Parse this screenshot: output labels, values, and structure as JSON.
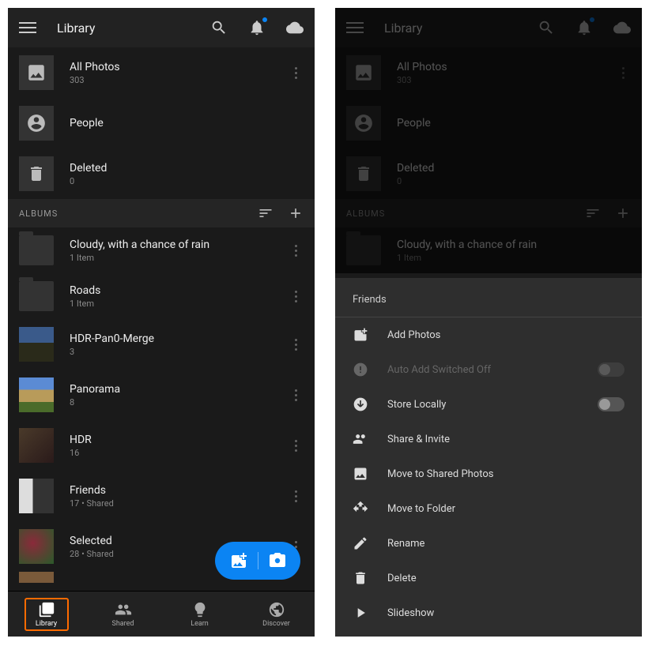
{
  "header": {
    "title": "Library"
  },
  "library": {
    "all_photos": {
      "label": "All Photos",
      "count": "303"
    },
    "people": {
      "label": "People"
    },
    "deleted": {
      "label": "Deleted",
      "count": "0"
    }
  },
  "albums_section": {
    "title": "ALBUMS"
  },
  "albums": [
    {
      "label": "Cloudy, with a chance of rain",
      "sub": "1 Item"
    },
    {
      "label": "Roads",
      "sub": "1 Item"
    },
    {
      "label": "HDR-Pan0-Merge",
      "sub": "3"
    },
    {
      "label": "Panorama",
      "sub": "8"
    },
    {
      "label": "HDR",
      "sub": "16"
    },
    {
      "label": "Friends",
      "sub": "17 • Shared"
    },
    {
      "label": "Selected",
      "sub": "28 • Shared"
    }
  ],
  "nav": {
    "library": "Library",
    "shared": "Shared",
    "learn": "Learn",
    "discover": "Discover"
  },
  "sheet": {
    "title": "Friends",
    "add_photos": "Add Photos",
    "auto_add": "Auto Add Switched Off",
    "store_locally": "Store Locally",
    "share_invite": "Share & Invite",
    "move_shared": "Move to Shared Photos",
    "move_folder": "Move to Folder",
    "rename": "Rename",
    "delete": "Delete",
    "slideshow": "Slideshow"
  },
  "colors": {
    "accent": "#0B84F3",
    "highlight": "#FF6B00"
  }
}
